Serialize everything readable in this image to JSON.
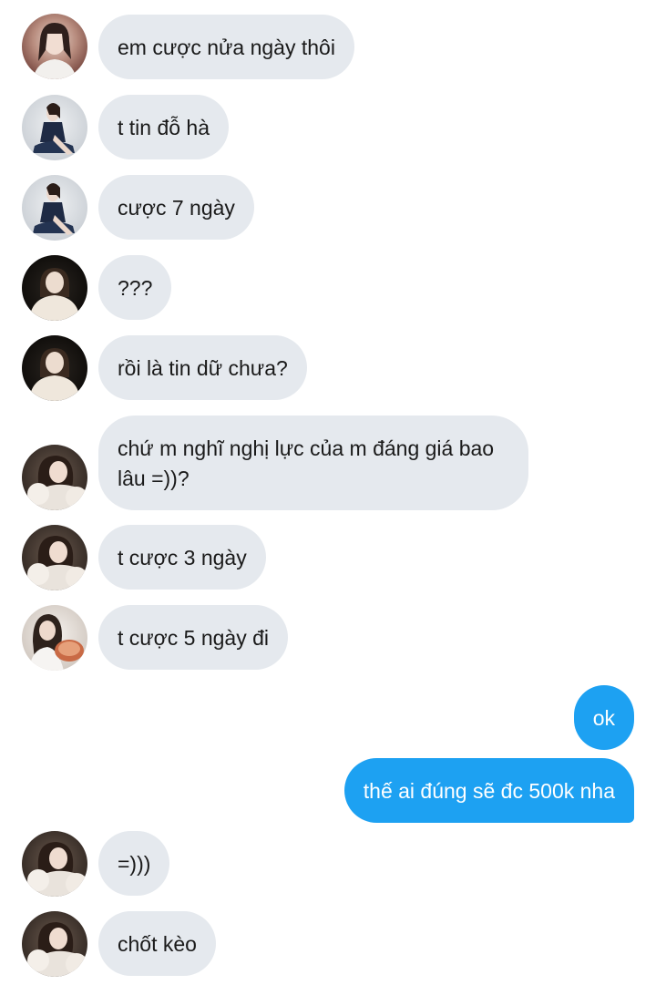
{
  "messages": [
    {
      "text": "em cược nửa ngày thôi",
      "avatar": "user-a-avatar"
    },
    {
      "text": "t tin đỗ hà",
      "avatar": "user-b-avatar"
    },
    {
      "text": "cược 7 ngày",
      "avatar": "user-b-avatar"
    },
    {
      "text": "???",
      "avatar": "user-c-avatar"
    },
    {
      "text": "rồi là tin dữ chưa?",
      "avatar": "user-c-avatar"
    },
    {
      "text": "chứ m nghĩ nghị lực của m đáng giá bao lâu =))?",
      "avatar": "user-d-avatar"
    },
    {
      "text": "t cược 3 ngày",
      "avatar": "user-d-avatar"
    },
    {
      "text": "t cược 5 ngày đi",
      "avatar": "user-e-avatar"
    },
    {
      "text": "ok",
      "avatar": ""
    },
    {
      "text": "thế ai đúng sẽ đc 500k nha",
      "avatar": ""
    },
    {
      "text": "=)))",
      "avatar": "user-d-avatar"
    },
    {
      "text": "chốt kèo",
      "avatar": "user-d-avatar"
    }
  ],
  "colors": {
    "incoming_bubble": "#e5e9ee",
    "outgoing_bubble": "#1da1f2",
    "incoming_text": "#1a1a1a",
    "outgoing_text": "#ffffff"
  }
}
